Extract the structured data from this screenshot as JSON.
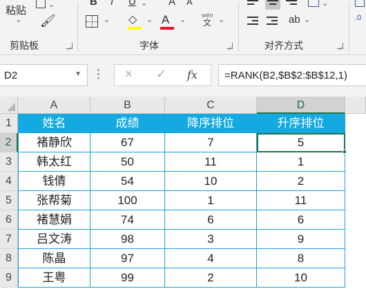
{
  "ribbon": {
    "clipboard": {
      "paste_label": "粘贴",
      "group_label": "剪贴板"
    },
    "font": {
      "bold": "B",
      "italic": "I",
      "underline": "U",
      "grow": "A",
      "shrink": "A",
      "phonetic_top": "wén",
      "phonetic_bottom": "文",
      "fill_color": "#ffff00",
      "font_color": "#e81123",
      "group_label": "字体"
    },
    "alignment": {
      "group_label": "对齐方式"
    },
    "number": {
      "partial": ".0"
    }
  },
  "formula_bar": {
    "name_box": "D2",
    "cancel": "×",
    "enter": "✓",
    "fx": "fx",
    "formula": "=RANK(B2,$B$2:$B$12,1)"
  },
  "grid": {
    "columns": [
      "A",
      "B",
      "C",
      "D"
    ],
    "rows": [
      "1",
      "2",
      "3",
      "4",
      "5",
      "6",
      "7",
      "8",
      "9"
    ],
    "active_cell": "D2",
    "header_fill": "#14a9e1",
    "border_color": "#1aa0d8",
    "header": [
      "姓名",
      "成绩",
      "降序排位",
      "升序排位"
    ],
    "data": [
      [
        "褚静欣",
        "67",
        "7",
        "5"
      ],
      [
        "韩太红",
        "50",
        "11",
        "1"
      ],
      [
        "钱倩",
        "54",
        "10",
        "2"
      ],
      [
        "张帮菊",
        "100",
        "1",
        "11"
      ],
      [
        "褚慧娟",
        "74",
        "6",
        "6"
      ],
      [
        "吕文涛",
        "98",
        "3",
        "9"
      ],
      [
        "陈晶",
        "97",
        "4",
        "8"
      ],
      [
        "王粤",
        "99",
        "2",
        "10"
      ]
    ]
  }
}
